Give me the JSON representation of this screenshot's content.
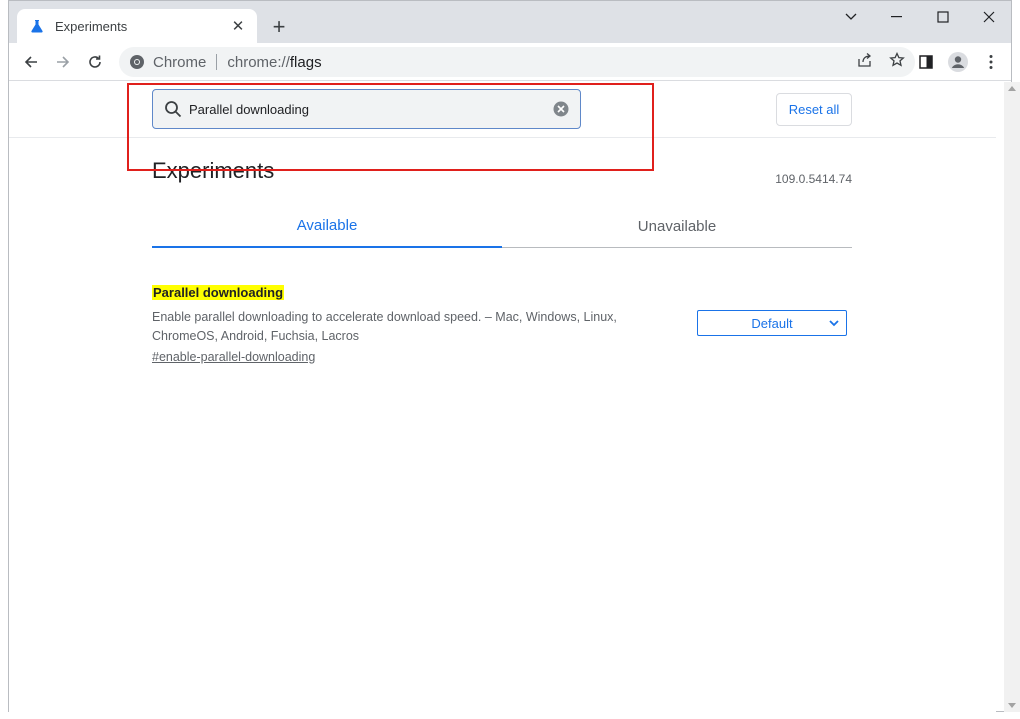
{
  "browser": {
    "tab_title": "Experiments",
    "tab_close": "✕",
    "new_tab": "+",
    "omnibox_site": "Chrome",
    "omnibox_scheme": "chrome://",
    "omnibox_host": "flags"
  },
  "header": {
    "search_value": "Parallel downloading",
    "reset_label": "Reset all"
  },
  "main": {
    "title": "Experiments",
    "version": "109.0.5414.74",
    "tabs": [
      {
        "label": "Available"
      },
      {
        "label": "Unavailable"
      }
    ]
  },
  "flags": [
    {
      "name": "Parallel downloading",
      "description": "Enable parallel downloading to accelerate download speed. – Mac, Windows, Linux, ChromeOS, Android, Fuchsia, Lacros",
      "link": "#enable-parallel-downloading",
      "selected": "Default"
    }
  ],
  "colors": {
    "accent": "#1a73e8",
    "highlight": "#ffff00",
    "annotation": "#e0201c"
  }
}
